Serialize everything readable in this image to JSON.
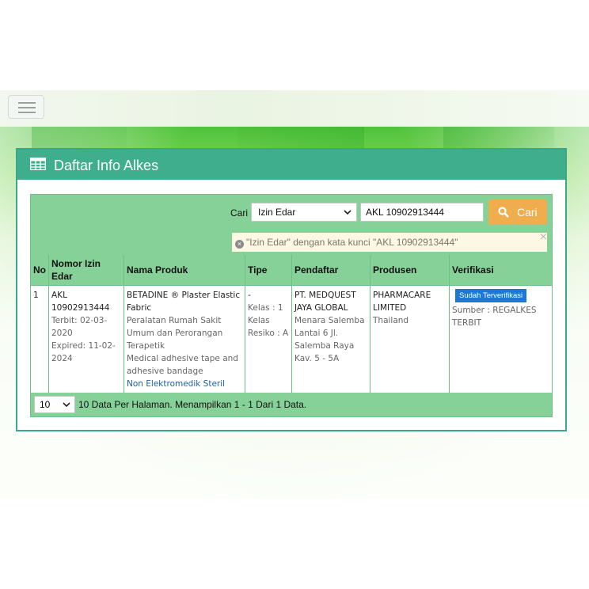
{
  "header": {
    "title": "Daftar Info Alkes"
  },
  "search": {
    "label": "Cari",
    "field_selected": "Izin Edar",
    "keyword": "AKL 10902913444",
    "button_label": "Cari",
    "notice": "\"Izin Edar\" dengan kata kunci \"AKL 10902913444\"",
    "notice_close": "×"
  },
  "table": {
    "columns": [
      "No",
      "Nomor Izin Edar",
      "Nama Produk",
      "Tipe",
      "Pendaftar",
      "Produsen",
      "Verifikasi"
    ],
    "rows": [
      {
        "no": "1",
        "nomor": "AKL 10902913444",
        "terbit": "Terbit: 02-03-2020",
        "expired": "Expired: 11-02-2024",
        "produk_name": "BETADINE ® Plaster Elastic Fabric",
        "produk_kategori": "Peralatan Rumah Sakit Umum dan Perorangan Terapetik",
        "produk_desc": "Medical adhesive tape and adhesive bandage",
        "produk_jenis": "Non Elektromedik Steril",
        "tipe": "-",
        "kelas": "Kelas : 1 Kelas Resiko : A",
        "pendaftar": "PT. MEDQUEST JAYA GLOBAL",
        "pendaftar_alamat": "Menara Salemba Lantai 6 Jl. Salemba Raya Kav. 5 - 5A",
        "produsen": "PHARMACARE LIMITED",
        "produsen_negara": "Thailand",
        "verifikasi_badge": "Sudah Terverifikasi",
        "sumber": "Sumber : REGALKES TERBIT"
      }
    ]
  },
  "footer": {
    "per_page": "10",
    "summary": "10 Data Per Halaman. Menampilkan 1 - 1 Dari 1 Data."
  },
  "colors": {
    "panel_header": "#3fae8c",
    "table_green": "#86d198",
    "button_orange": "#f0ad4e",
    "badge_blue": "#1b78d4"
  },
  "icons": [
    "hamburger-menu-icon",
    "table-grid-icon",
    "search-icon",
    "close-circle-icon",
    "chevron-down-icon"
  ]
}
